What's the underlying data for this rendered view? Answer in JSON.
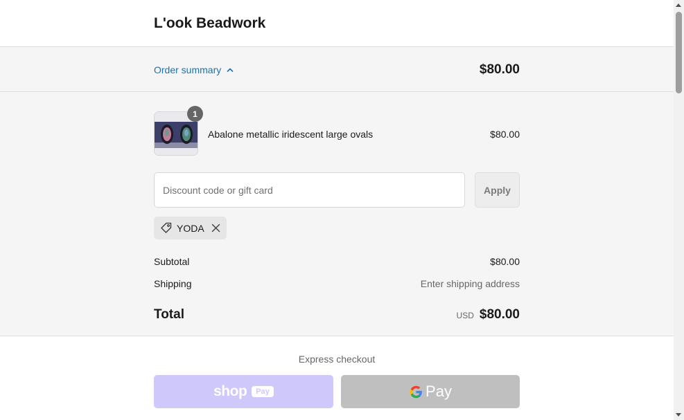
{
  "header": {
    "shop_name": "L'ook Beadwork"
  },
  "summary_bar": {
    "toggle_label": "Order summary",
    "amount": "$80.00"
  },
  "line_item": {
    "name": "Abalone metallic iridescent large ovals",
    "price": "$80.00",
    "quantity": "1"
  },
  "discount": {
    "placeholder": "Discount code or gift card",
    "apply_label": "Apply",
    "applied_code": "YODA"
  },
  "totals": {
    "subtotal_label": "Subtotal",
    "subtotal_value": "$80.00",
    "shipping_label": "Shipping",
    "shipping_value": "Enter shipping address",
    "total_label": "Total",
    "currency": "USD",
    "total_value": "$80.00"
  },
  "express": {
    "label": "Express checkout",
    "shop_pay_word": "shop",
    "shop_pay_pill": "Pay",
    "gpay_word": "Pay"
  },
  "colors": {
    "link": "#1773b0",
    "shop_pay": "#cfc8fb",
    "gpay": "#bfbfbf",
    "summary_bg": "#f5f5f5"
  },
  "icons": [
    "chevron-up-icon",
    "tag-icon",
    "close-icon",
    "google-g-icon"
  ]
}
